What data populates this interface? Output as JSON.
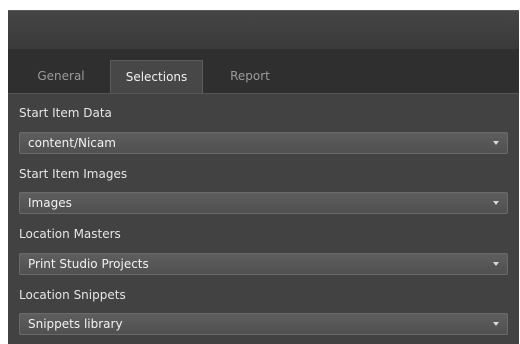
{
  "tabs": {
    "general": "General",
    "selections": "Selections",
    "report": "Report",
    "active": "Selections"
  },
  "fields": {
    "start_item_data": {
      "label": "Start Item Data",
      "value": "content/Nicam"
    },
    "start_item_images": {
      "label": "Start Item Images",
      "value": "Images"
    },
    "location_masters": {
      "label": "Location Masters",
      "value": "Print Studio Projects"
    },
    "location_snippets": {
      "label": "Location Snippets",
      "value": "Snippets library"
    }
  },
  "icons": {
    "dropdown_arrow": "chevron-down-icon"
  },
  "colors": {
    "panel_bg": "#424242",
    "tabstrip_bg": "#2f2f2f",
    "active_tab_bg": "#474747",
    "dropdown_bg": "#575757",
    "text": "#e6e6e6",
    "inactive_tab_text": "#9b9b9b"
  }
}
